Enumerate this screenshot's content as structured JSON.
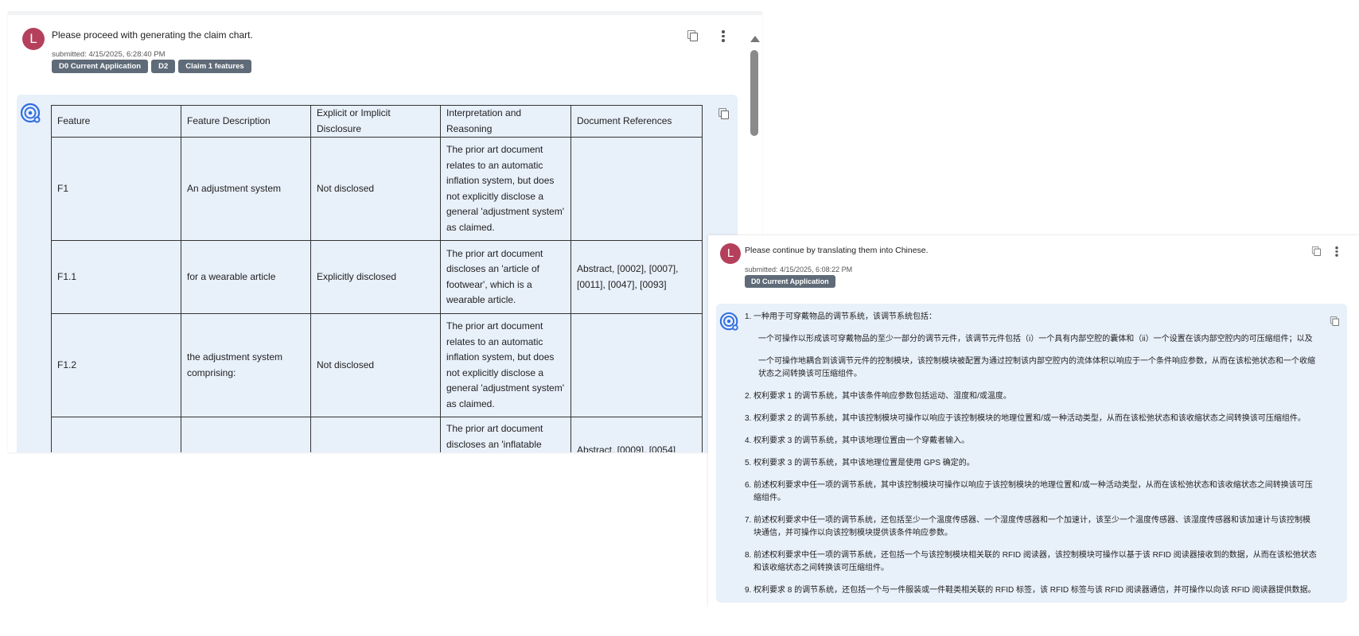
{
  "message1": {
    "avatar_letter": "L",
    "text": "Please proceed with generating the claim chart.",
    "submitted": "submitted: 4/15/2025, 6:28:40 PM",
    "chips": [
      "D0 Current Application",
      "D2",
      "Claim 1 features"
    ]
  },
  "claim_table": {
    "headers": [
      "Feature",
      "Feature Description",
      "Explicit or Implicit Disclosure",
      "Interpretation and Reasoning",
      "Document References"
    ],
    "rows": [
      {
        "feature": "F1",
        "description": "An adjustment system",
        "disclosure": "Not disclosed",
        "reasoning": "The prior art document relates to an automatic inflation system, but does not explicitly disclose a general 'adjustment system' as claimed.",
        "references": ""
      },
      {
        "feature": "F1.1",
        "description": "for a wearable article",
        "disclosure": "Explicitly disclosed",
        "reasoning": "The prior art document discloses an 'article of footwear', which is a wearable article.",
        "references": "Abstract, [0002], [0007], [0011], [0047], [0093]"
      },
      {
        "feature": "F1.2",
        "description": "the adjustment system comprising:",
        "disclosure": "Not disclosed",
        "reasoning": "The prior art document relates to an automatic inflation system, but does not explicitly disclose a general 'adjustment system' as claimed.",
        "references": ""
      },
      {
        "feature": "",
        "description": "",
        "disclosure": "",
        "reasoning": "The prior art document discloses an 'inflatable",
        "references": "Abstract, [0009], [0054]"
      }
    ]
  },
  "message2": {
    "avatar_letter": "L",
    "text": "Please continue by translating them into Chinese.",
    "submitted": "submitted: 4/15/2025, 6:08:22 PM",
    "chips": [
      "D0 Current Application"
    ]
  },
  "translation": {
    "items": [
      {
        "num": "1.",
        "text": "一种用于可穿戴物品的调节系统，该调节系统包括："
      },
      {
        "num": "",
        "text": "一个可操作以形成该可穿戴物品的至少一部分的调节元件，该调节元件包括（i）一个具有内部空腔的囊体和（ii）一个设置在该内部空腔内的可压缩组件；以及"
      },
      {
        "num": "",
        "text": "一个可操作地耦合到该调节元件的控制模块，该控制模块被配置为通过控制该内部空腔内的流体体积以响应于一个条件响应参数，从而在该松弛状态和一个收缩状态之间转换该可压缩组件。"
      },
      {
        "num": "2.",
        "text": "权利要求 1 的调节系统，其中该条件响应参数包括运动、湿度和/或温度。"
      },
      {
        "num": "3.",
        "text": "权利要求 2 的调节系统，其中该控制模块可操作以响应于该控制模块的地理位置和/或一种活动类型，从而在该松弛状态和该收缩状态之间转换该可压缩组件。"
      },
      {
        "num": "4.",
        "text": "权利要求 3 的调节系统，其中该地理位置由一个穿戴者输入。"
      },
      {
        "num": "5.",
        "text": "权利要求 3 的调节系统，其中该地理位置是使用 GPS 确定的。"
      },
      {
        "num": "6.",
        "text": "前述权利要求中任一项的调节系统，其中该控制模块可操作以响应于该控制模块的地理位置和/或一种活动类型，从而在该松弛状态和该收缩状态之间转换该可压缩组件。"
      },
      {
        "num": "7.",
        "text": "前述权利要求中任一项的调节系统，还包括至少一个温度传感器、一个湿度传感器和一个加速计，该至少一个温度传感器、该湿度传感器和该加速计与该控制模块通信，并可操作以向该控制模块提供该条件响应参数。"
      },
      {
        "num": "8.",
        "text": "前述权利要求中任一项的调节系统，还包括一个与该控制模块相关联的 RFID 阅读器，该控制模块可操作以基于该 RFID 阅读器接收到的数据，从而在该松弛状态和该收缩状态之间转换该可压缩组件。"
      },
      {
        "num": "9.",
        "text": "权利要求 8 的调节系统，还包括一个与一件服装或一件鞋类相关联的 RFID 标签，该 RFID 标签与该 RFID 阅读器通信，并可操作以向该 RFID 阅读器提供数据。"
      }
    ]
  }
}
